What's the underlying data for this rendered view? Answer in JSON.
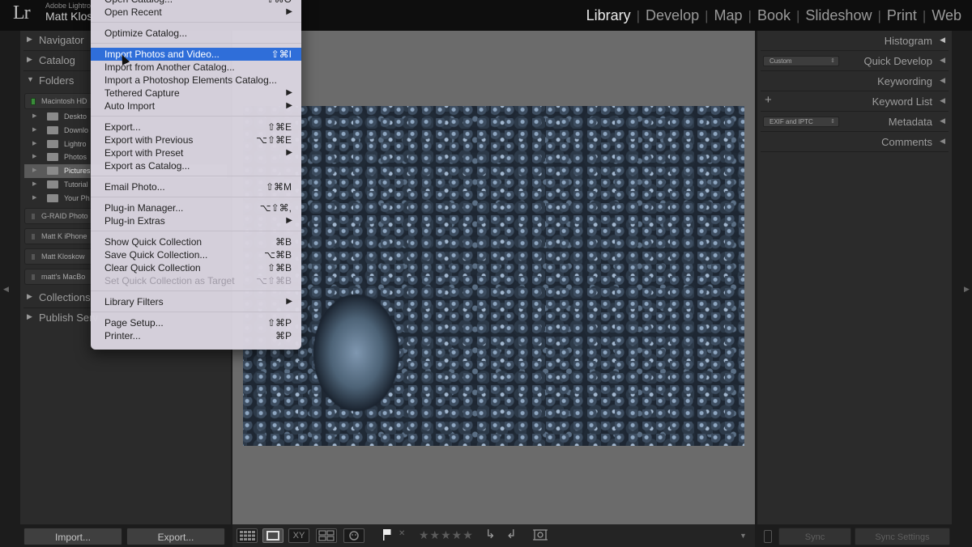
{
  "header": {
    "logo": "Lr",
    "app_name": "Adobe Lightro",
    "user_name": "Matt Klos",
    "modules": [
      "Library",
      "Develop",
      "Map",
      "Book",
      "Slideshow",
      "Print",
      "Web"
    ],
    "active_module": "Library"
  },
  "left_panel": {
    "sections": {
      "navigator": "Navigator",
      "catalog": "Catalog",
      "folders": "Folders",
      "collections": "Collections",
      "publish": "Publish Serv"
    },
    "volumes": [
      {
        "name": "Macintosh HD",
        "online": true
      },
      {
        "name": "G-RAID Photo",
        "online": false
      },
      {
        "name": "Matt K iPhone",
        "online": false
      },
      {
        "name": "Matt Kloskow",
        "online": false
      },
      {
        "name": "matt's MacBo",
        "online": false
      }
    ],
    "folders": [
      {
        "name": "Deskto",
        "selected": false
      },
      {
        "name": "Downlo",
        "selected": false
      },
      {
        "name": "Lightro",
        "selected": false
      },
      {
        "name": "Photos",
        "selected": false
      },
      {
        "name": "Pictures",
        "selected": true
      },
      {
        "name": "Tutorial",
        "selected": false
      },
      {
        "name": "Your Ph",
        "selected": false
      }
    ],
    "import_label": "Import...",
    "export_label": "Export..."
  },
  "menu": {
    "items": [
      {
        "label": "Open Catalog...",
        "shortcut": "⇧⌘O",
        "submenu": false,
        "disabled": false,
        "highlighted": false,
        "sep_after": false
      },
      {
        "label": "Open Recent",
        "shortcut": "",
        "submenu": true,
        "disabled": false,
        "highlighted": false,
        "sep_after": true
      },
      {
        "label": "Optimize Catalog...",
        "shortcut": "",
        "submenu": false,
        "disabled": false,
        "highlighted": false,
        "sep_after": true
      },
      {
        "label": "Import Photos and Video...",
        "shortcut": "⇧⌘I",
        "submenu": false,
        "disabled": false,
        "highlighted": true,
        "sep_after": false
      },
      {
        "label": "Import from Another Catalog...",
        "shortcut": "",
        "submenu": false,
        "disabled": false,
        "highlighted": false,
        "sep_after": false
      },
      {
        "label": "Import a Photoshop Elements Catalog...",
        "shortcut": "",
        "submenu": false,
        "disabled": false,
        "highlighted": false,
        "sep_after": false
      },
      {
        "label": "Tethered Capture",
        "shortcut": "",
        "submenu": true,
        "disabled": false,
        "highlighted": false,
        "sep_after": false
      },
      {
        "label": "Auto Import",
        "shortcut": "",
        "submenu": true,
        "disabled": false,
        "highlighted": false,
        "sep_after": true
      },
      {
        "label": "Export...",
        "shortcut": "⇧⌘E",
        "submenu": false,
        "disabled": false,
        "highlighted": false,
        "sep_after": false
      },
      {
        "label": "Export with Previous",
        "shortcut": "⌥⇧⌘E",
        "submenu": false,
        "disabled": false,
        "highlighted": false,
        "sep_after": false
      },
      {
        "label": "Export with Preset",
        "shortcut": "",
        "submenu": true,
        "disabled": false,
        "highlighted": false,
        "sep_after": false
      },
      {
        "label": "Export as Catalog...",
        "shortcut": "",
        "submenu": false,
        "disabled": false,
        "highlighted": false,
        "sep_after": true
      },
      {
        "label": "Email Photo...",
        "shortcut": "⇧⌘M",
        "submenu": false,
        "disabled": false,
        "highlighted": false,
        "sep_after": true
      },
      {
        "label": "Plug-in Manager...",
        "shortcut": "⌥⇧⌘,",
        "submenu": false,
        "disabled": false,
        "highlighted": false,
        "sep_after": false
      },
      {
        "label": "Plug-in Extras",
        "shortcut": "",
        "submenu": true,
        "disabled": false,
        "highlighted": false,
        "sep_after": true
      },
      {
        "label": "Show Quick Collection",
        "shortcut": "⌘B",
        "submenu": false,
        "disabled": false,
        "highlighted": false,
        "sep_after": false
      },
      {
        "label": "Save Quick Collection...",
        "shortcut": "⌥⌘B",
        "submenu": false,
        "disabled": false,
        "highlighted": false,
        "sep_after": false
      },
      {
        "label": "Clear Quick Collection",
        "shortcut": "⇧⌘B",
        "submenu": false,
        "disabled": false,
        "highlighted": false,
        "sep_after": false
      },
      {
        "label": "Set Quick Collection as Target",
        "shortcut": "⌥⇧⌘B",
        "submenu": false,
        "disabled": true,
        "highlighted": false,
        "sep_after": true
      },
      {
        "label": "Library Filters",
        "shortcut": "",
        "submenu": true,
        "disabled": false,
        "highlighted": false,
        "sep_after": true
      },
      {
        "label": "Page Setup...",
        "shortcut": "⇧⌘P",
        "submenu": false,
        "disabled": false,
        "highlighted": false,
        "sep_after": false
      },
      {
        "label": "Printer...",
        "shortcut": "⌘P",
        "submenu": false,
        "disabled": false,
        "highlighted": false,
        "sep_after": false
      }
    ]
  },
  "right_panel": {
    "histogram": "Histogram",
    "quick_develop": "Quick Develop",
    "quick_develop_preset": "Custom",
    "keywording": "Keywording",
    "keyword_list": "Keyword List",
    "metadata": "Metadata",
    "metadata_preset": "EXIF and IPTC",
    "comments": "Comments",
    "sync_label": "Sync",
    "sync_settings_label": "Sync Settings"
  },
  "toolbar": {
    "stars": "★★★★★",
    "rating": 0,
    "compare_label": "XY",
    "flag_icon": "flag-icon"
  }
}
